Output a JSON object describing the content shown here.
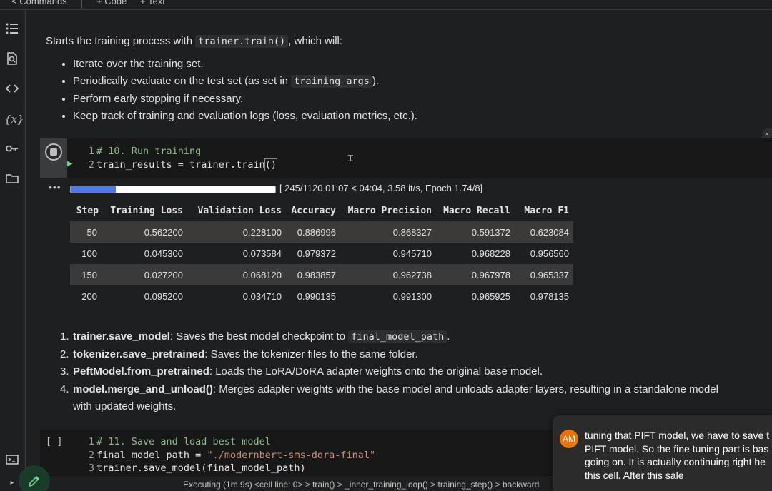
{
  "topbar": {
    "commands_label": "Commands",
    "code_label": "+ Code",
    "text_label": "+ Text"
  },
  "rail": {
    "icons": [
      "table-of-contents-icon",
      "find-icon",
      "code-snippets-icon",
      "variables-icon",
      "secrets-key-icon",
      "files-folder-icon",
      "terminal-icon"
    ]
  },
  "text_cell": {
    "intro_before": "Starts the training process with ",
    "intro_code": "trainer.train()",
    "intro_after": ", which will:",
    "bullets": [
      {
        "text": "Iterate over the training set."
      },
      {
        "text_before": "Periodically evaluate on the test set (as set in ",
        "code": "training_args",
        "text_after": ")."
      },
      {
        "text": "Perform early stopping if necessary."
      },
      {
        "text": "Keep track of training and evaluation logs (loss, evaluation metrics, etc.)."
      }
    ]
  },
  "code_cell_1": {
    "lines": [
      {
        "num": "1",
        "comment": "# 10. Run training"
      },
      {
        "num": "2",
        "code": "train_results = trainer.train",
        "paren": "()"
      }
    ]
  },
  "output": {
    "dots": "•••",
    "progress_fraction": 0.219,
    "progress_text": "[ 245/1120 01:07 < 04:04, 3.58 it/s, Epoch 1.74/8]",
    "table": {
      "headers": [
        "Step",
        "Training Loss",
        "Validation Loss",
        "Accuracy",
        "Macro Precision",
        "Macro Recall",
        "Macro F1"
      ],
      "rows": [
        [
          "50",
          "0.562200",
          "0.228100",
          "0.886996",
          "0.868327",
          "0.591372",
          "0.623084"
        ],
        [
          "100",
          "0.045300",
          "0.073584",
          "0.979372",
          "0.945710",
          "0.968228",
          "0.956560"
        ],
        [
          "150",
          "0.027200",
          "0.068120",
          "0.983857",
          "0.962738",
          "0.967978",
          "0.965337"
        ],
        [
          "200",
          "0.095200",
          "0.034710",
          "0.990135",
          "0.991300",
          "0.965925",
          "0.978135"
        ]
      ]
    }
  },
  "numbered_list": [
    {
      "num": "1.",
      "bold": "trainer.save_model",
      "text": ": Saves the best model checkpoint to ",
      "code": "final_model_path",
      "after": "."
    },
    {
      "num": "2.",
      "bold": "tokenizer.save_pretrained",
      "text": ": Saves the tokenizer files to the same folder."
    },
    {
      "num": "3.",
      "bold": "PeftModel.from_pretrained",
      "text": ": Loads the LoRA/DoRA adapter weights onto the original base model."
    },
    {
      "num": "4.",
      "bold": "model.merge_and_unload()",
      "text": ": Merges adapter weights with the base model and unloads adapter layers, resulting in a standalone model",
      "line2": "with updated weights."
    }
  ],
  "code_cell_2": {
    "bracket": "[ ]",
    "lines": [
      {
        "num": "1",
        "comment": "# 11. Save and load best model"
      },
      {
        "num": "2",
        "code": "final_model_path = ",
        "string": "\"./modernbert-sms-dora-final\""
      },
      {
        "num": "3",
        "code": "trainer.save_model(final_model_path)"
      }
    ]
  },
  "status_bar": {
    "text": "Executing (1m 9s)  <cell line: 0> > train() > _inner_training_loop() > training_step() > backward"
  },
  "chat": {
    "avatar": "AM",
    "lines": [
      "tuning that PIFT model, we have to save t",
      "PIFT model. So the fine tuning part is bas",
      "going on. It is actually continuing right he",
      "this cell. After this sale"
    ]
  }
}
